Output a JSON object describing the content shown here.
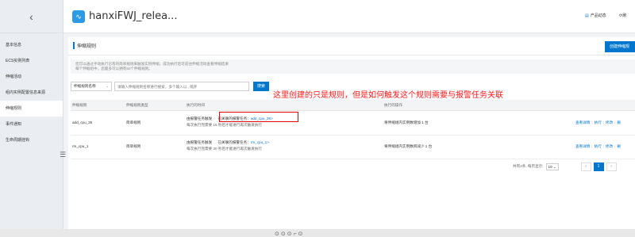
{
  "sidebar": {
    "back_icon": "chevron-left-icon",
    "back_glyph": "‹",
    "items": [
      {
        "label": "基本信息"
      },
      {
        "label": "ECS实例列表"
      },
      {
        "label": "伸缩活动"
      },
      {
        "label": "组内实例配置信息来源"
      },
      {
        "label": "伸缩规则"
      },
      {
        "label": "事件通知"
      },
      {
        "label": "生命周期挂钩"
      }
    ],
    "collapse_glyph": "☰"
  },
  "header": {
    "logo_glyph": "∿",
    "title": "hanxiFWJ_relea...",
    "updates_label": "产品动态",
    "refresh_label": "刷"
  },
  "main": {
    "section_title": "伸缩规则",
    "create_button": "创建伸缩规",
    "notice_line1": "您可以通过手动执行已有的简单规则来触发实例伸缩，成功执行后可前往伸缩活动查看伸缩结果",
    "notice_line2": "每个伸缩组中，您最多可以拥有50个伸缩规则。",
    "filter": {
      "select_value": "伸缩规则名称",
      "input_placeholder": "请输入伸缩规则名称进行搜索，多个输入以 , 隔开",
      "search_button": "搜索"
    },
    "annotation": "这里创建的只是规则，但是如何触发这个规则需要与报警任务关联",
    "table": {
      "columns": [
        "伸缩规则",
        "伸缩规则类型",
        "执行的时间",
        "执行的操作"
      ],
      "rows": [
        {
          "name": "add_cpu_35",
          "type": "简单规则",
          "time_line1_prefix": "由报警任务触发",
          "time_line1_assoc": "已关联的报警任务：",
          "time_line1_link": "add_cpu_35>",
          "time_line2": "每次执行完需要 15 秒后才能进行再次触发执行",
          "operation": "将伸缩组内实例数增加 1 台",
          "actions": [
            "查看详情",
            "执行",
            "修改",
            "删"
          ]
        },
        {
          "name": "rm_cpu_1",
          "type": "简单规则",
          "time_line1_prefix": "由报警任务触发",
          "time_line1_assoc": "已关联的报警任务：",
          "time_line1_link": "rm_cpu_1>",
          "time_line2": "每次执行完需要 30 秒后才能进行再次触发执行",
          "operation": "将伸缩组内实例数目减少 1 台",
          "actions": [
            "查看详情",
            "执行",
            "修改",
            "删"
          ]
        }
      ]
    },
    "pagination": {
      "summary": "共有2条, 每页显示:",
      "page_size": "10",
      "prev": "‹",
      "current": "1",
      "next": "›"
    }
  },
  "bottombar": {
    "icons": "⊙⊙⊙⌐⊙"
  },
  "colors": {
    "accent": "#0077cc",
    "annotation": "#ff1a1a",
    "sidebar_bg": "#eaedf1"
  }
}
